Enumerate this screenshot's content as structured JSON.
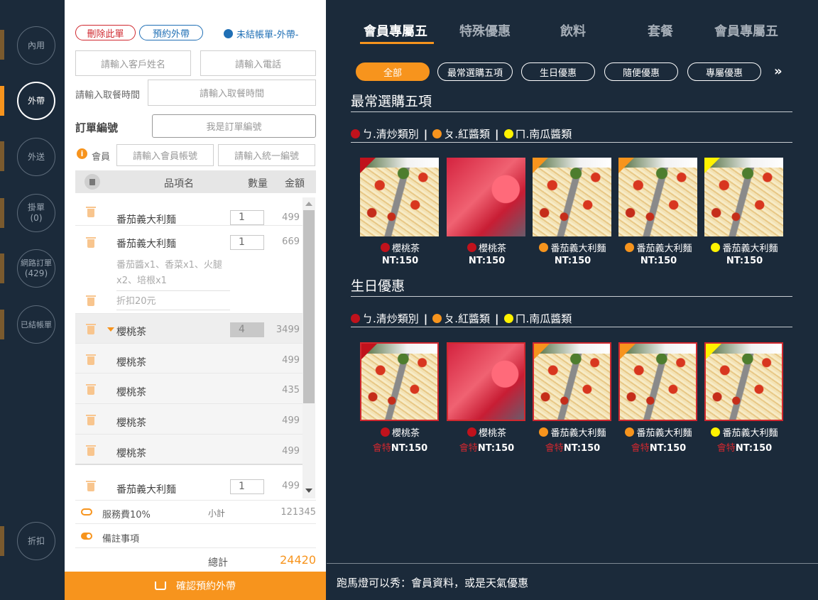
{
  "rail": {
    "items": [
      {
        "label": "內用"
      },
      {
        "label": "外帶"
      },
      {
        "label": "外送"
      },
      {
        "label": "掛單",
        "count": "(0)"
      },
      {
        "label": "網路訂單",
        "count": "(429)"
      },
      {
        "label": "已結帳單"
      },
      {
        "label": "折扣"
      }
    ]
  },
  "order": {
    "delete_label": "刪除此單",
    "reserve_label": "預約外帶",
    "status": "未結帳單-外帶-",
    "customer_name_placeholder": "請輸入客戶姓名",
    "phone_placeholder": "請輸入電話",
    "pickup_time_label": "請輸入取餐時間",
    "pickup_time_placeholder": "請輸入取餐時間",
    "order_no_label": "訂單編號",
    "order_no_value": "我是訂單編號",
    "member_label": "會員",
    "member_account_placeholder": "請輸入會員帳號",
    "tax_id_placeholder": "請輸入統一編號",
    "col_item": "品項名",
    "col_qty": "數量",
    "col_amount": "金額",
    "items": [
      {
        "name": "番茄義大利麵",
        "qty": "1",
        "amount": "499"
      },
      {
        "name": "番茄義大利麵",
        "qty": "1",
        "amount": "669",
        "options": "番茄醬x1、香菜x1、火腿x2、培根x1",
        "discount": "折扣20元"
      },
      {
        "name": "櫻桃茶",
        "qty": "4",
        "amount": "3499"
      },
      {
        "name": "櫻桃茶",
        "amount": "499"
      },
      {
        "name": "櫻桃茶",
        "amount": "435"
      },
      {
        "name": "櫻桃茶",
        "amount": "499"
      },
      {
        "name": "櫻桃茶",
        "amount": "499"
      },
      {
        "name": "番茄義大利麵",
        "qty": "1",
        "amount": "499"
      }
    ],
    "service_fee_label": "服務費10%",
    "subtotal_label": "小計",
    "subtotal_value": "121345",
    "note_label": "備註事項",
    "total_label": "總計",
    "total_value": "24420",
    "confirm_label": "確認預約外帶"
  },
  "menu": {
    "tabs": [
      "會員專屬五",
      "特殊優惠",
      "飲料",
      "套餐",
      "會員專屬五"
    ],
    "chips": [
      "全部",
      "最常選購五項",
      "生日優惠",
      "隨便優惠",
      "專屬優惠"
    ],
    "more_icon": "double-chevron-right-icon",
    "legend": [
      {
        "label": "ㄅ.清炒類別",
        "color": "#c0121c"
      },
      {
        "label": "ㄆ.紅醬類",
        "color": "#f7941d"
      },
      {
        "label": "ㄇ.南瓜醬類",
        "color": "#fff200"
      }
    ],
    "sections": [
      {
        "title": "最常選購五項",
        "items": [
          {
            "name": "櫻桃茶",
            "price": "NT:150",
            "dot": "#c0121c",
            "img": "pasta",
            "corner": "#c0121c"
          },
          {
            "name": "櫻桃茶",
            "price": "NT:150",
            "dot": "#c0121c",
            "img": "tea",
            "corner": ""
          },
          {
            "name": "番茄義大利麵",
            "price": "NT:150",
            "dot": "#f7941d",
            "img": "pasta",
            "corner": "#f7941d"
          },
          {
            "name": "番茄義大利麵",
            "price": "NT:150",
            "dot": "#f7941d",
            "img": "pasta",
            "corner": "#f7941d"
          },
          {
            "name": "番茄義大利麵",
            "price": "NT:150",
            "dot": "#fff200",
            "img": "pasta",
            "corner": "#fff200"
          }
        ]
      },
      {
        "title": "生日優惠",
        "price_tag": "會特",
        "items": [
          {
            "name": "櫻桃茶",
            "price": "NT:150",
            "dot": "#c0121c",
            "img": "pasta",
            "corner": "#c0121c"
          },
          {
            "name": "櫻桃茶",
            "price": "NT:150",
            "dot": "#c0121c",
            "img": "tea",
            "corner": ""
          },
          {
            "name": "番茄義大利麵",
            "price": "NT:150",
            "dot": "#f7941d",
            "img": "pasta",
            "corner": "#f7941d"
          },
          {
            "name": "番茄義大利麵",
            "price": "NT:150",
            "dot": "#f7941d",
            "img": "pasta",
            "corner": "#f7941d"
          },
          {
            "name": "番茄義大利麵",
            "price": "NT:150",
            "dot": "#fff200",
            "img": "pasta",
            "corner": "#fff200"
          }
        ]
      }
    ],
    "ticker": "跑馬燈可以秀：會員資料，或是天氣優惠"
  },
  "colors": {
    "accent": "#f7941d",
    "background": "#1b2a3a",
    "danger": "#d0282f",
    "info": "#1f6fb5"
  }
}
